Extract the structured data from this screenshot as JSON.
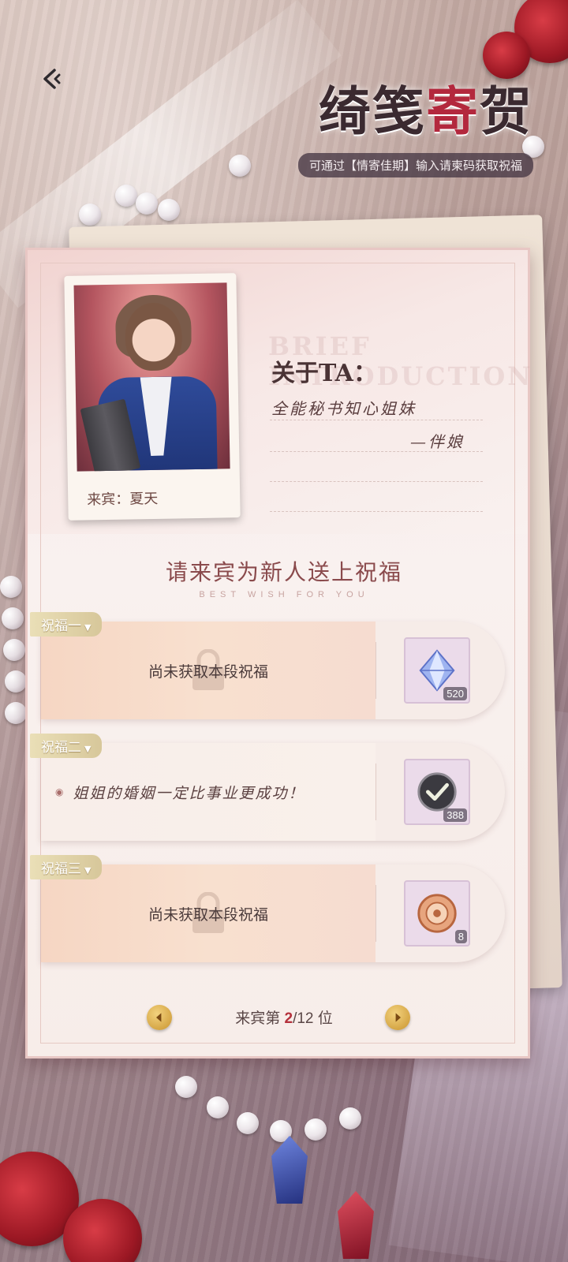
{
  "header": {
    "title_part1": "绮笺",
    "title_part2": "寄",
    "title_part3": "贺",
    "subtitle": "可通过【情寄佳期】输入请柬码获取祝福"
  },
  "guest": {
    "photo_label": "来宾：夏天",
    "about_title": "关于TA：",
    "about_bg": "BRIEF INTRODUCTION",
    "about_line1": "全能秘书知心姐妹",
    "about_line2": "—伴娘"
  },
  "wishes": {
    "heading": "请来宾为新人送上祝福",
    "heading_en": "BEST WISH FOR YOU",
    "items": [
      {
        "tag": "祝福一",
        "text": "尚未获取本段祝福",
        "reward_count": "520"
      },
      {
        "tag": "祝福二",
        "text": "姐姐的婚姻一定比事业更成功！",
        "reward_count": "388"
      },
      {
        "tag": "祝福三",
        "text": "尚未获取本段祝福",
        "reward_count": "8"
      }
    ]
  },
  "pager": {
    "prefix": "来宾第",
    "current": "2",
    "total": "/12",
    "suffix": "位"
  },
  "colors": {
    "accent": "#b3283d",
    "tag_gold": "#d7c79a"
  }
}
